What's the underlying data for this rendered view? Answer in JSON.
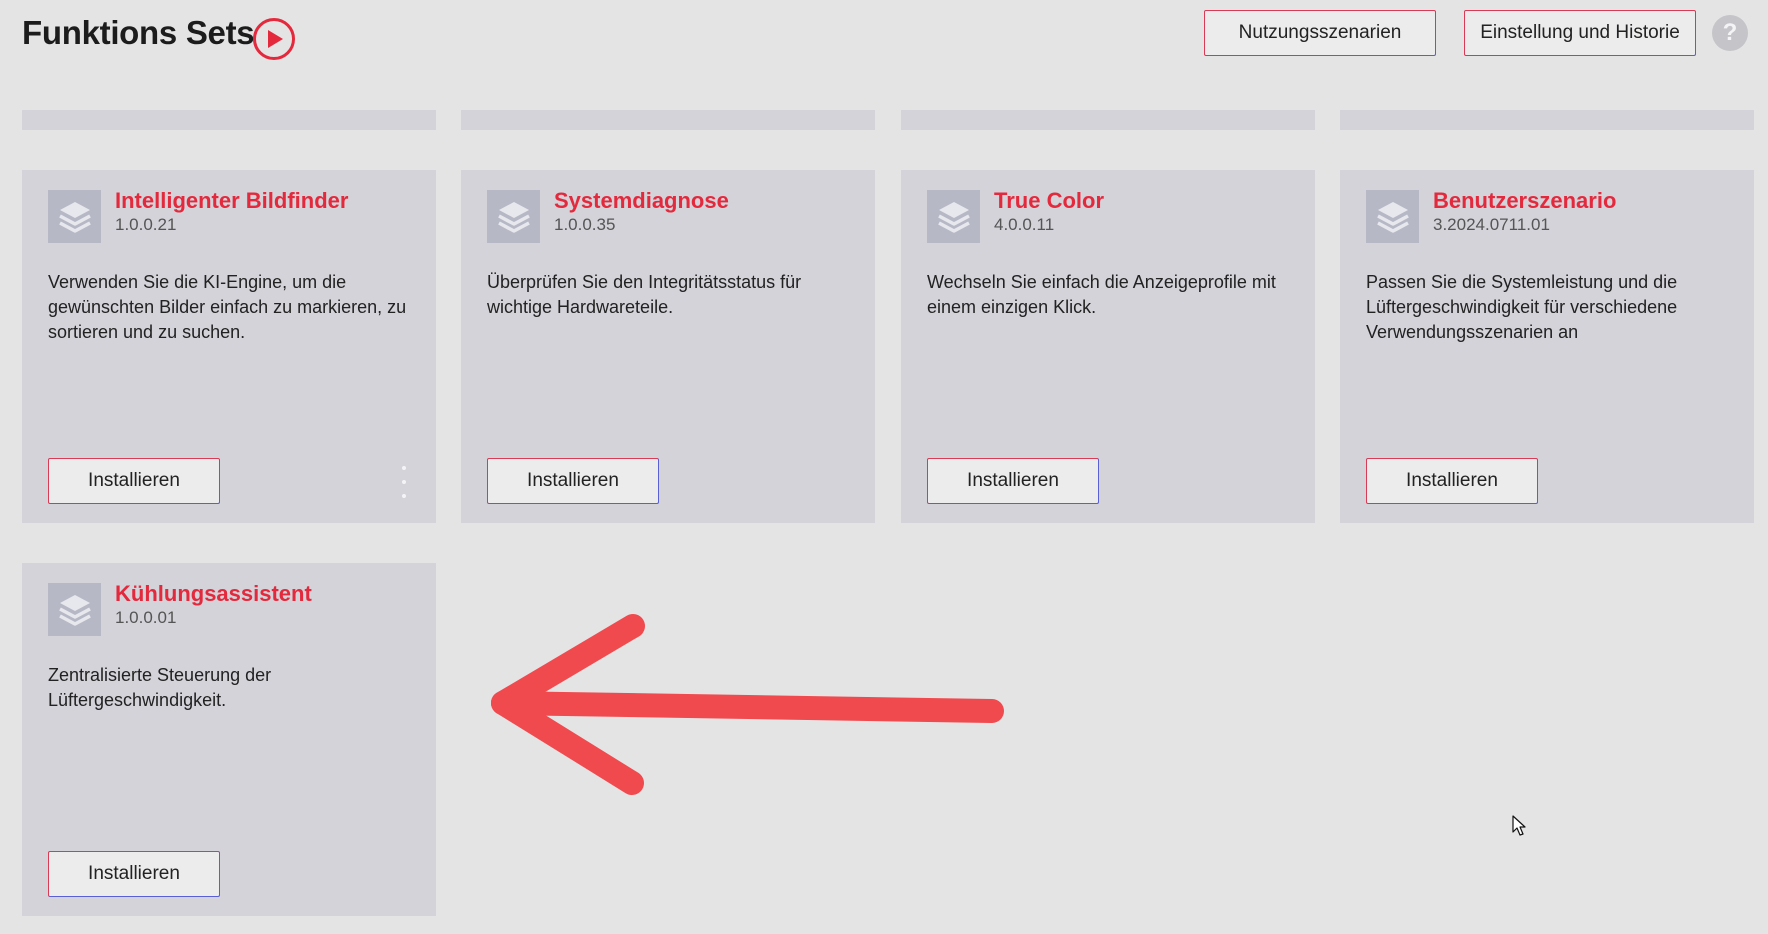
{
  "header": {
    "title": "Funktions Sets",
    "play_icon": "play-circle-icon",
    "buttons": {
      "scenarios": "Nutzungsszenarien",
      "settings": "Einstellung und Historie",
      "help": "?"
    }
  },
  "colors": {
    "accent": "#e4293d",
    "card_bg": "#d3d3d9",
    "page_bg": "#e4e4e5",
    "border_blue": "#5a5fd6",
    "annotation_arrow": "#f04a4e"
  },
  "cards": [
    {
      "name": "Intelligenter Bildfinder",
      "version": "1.0.0.21",
      "description": "Verwenden Sie die KI-Engine, um die gewünschten Bilder einfach zu markieren, zu sortieren und zu suchen.",
      "button": "Installieren",
      "icon": "layers-icon"
    },
    {
      "name": "Systemdiagnose",
      "version": "1.0.0.35",
      "description": "Überprüfen Sie den Integritätsstatus für wichtige Hardwareteile.",
      "button": "Installieren",
      "icon": "layers-icon"
    },
    {
      "name": "True Color",
      "version": "4.0.0.11",
      "description": "Wechseln Sie einfach die Anzeigeprofile mit einem einzigen Klick.",
      "button": "Installieren",
      "icon": "layers-icon"
    },
    {
      "name": "Benutzerszenario",
      "version": "3.2024.0711.01",
      "description": "Passen Sie die Systemleistung und die Lüftergeschwindigkeit für verschiedene Verwendungsszenarien an",
      "button": "Installieren",
      "icon": "layers-icon"
    },
    {
      "name": "Kühlungsassistent",
      "version": "1.0.0.01",
      "description": "Zentralisierte Steuerung der Lüftergeschwindigkeit.",
      "button": "Installieren",
      "icon": "layers-icon"
    }
  ],
  "annotation": {
    "type": "arrow",
    "points_to": "Kühlungsassistent"
  }
}
